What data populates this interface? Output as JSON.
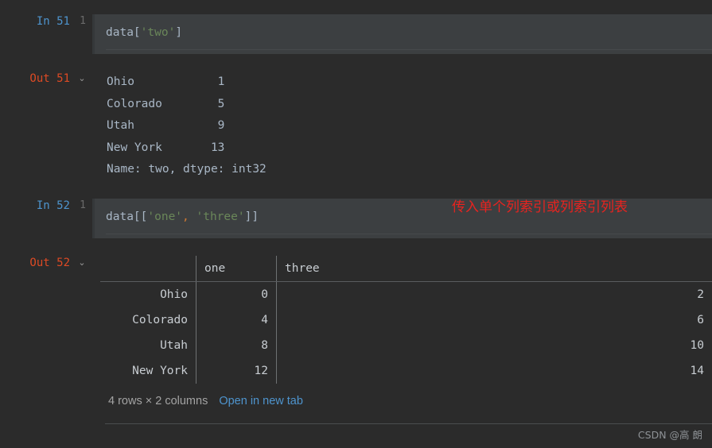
{
  "cells": [
    {
      "type": "input",
      "prompt_label": "In 51",
      "line_number": "1",
      "code_tokens": [
        {
          "text": "data",
          "kind": "name"
        },
        {
          "text": "[",
          "kind": "brack"
        },
        {
          "text": "'two'",
          "kind": "str"
        },
        {
          "text": "]",
          "kind": "brack"
        }
      ],
      "code_plain": "data['two']"
    },
    {
      "type": "output_text",
      "prompt_label": "Out 51",
      "collapse_icon": "chevron-down-icon",
      "lines": [
        "Ohio            1",
        "Colorado        5",
        "Utah            9",
        "New York       13",
        "Name: two, dtype: int32"
      ]
    },
    {
      "type": "input",
      "prompt_label": "In 52",
      "line_number": "1",
      "code_tokens": [
        {
          "text": "data",
          "kind": "name"
        },
        {
          "text": "[[",
          "kind": "brack"
        },
        {
          "text": "'one'",
          "kind": "str"
        },
        {
          "text": ",",
          "kind": "punct"
        },
        {
          "text": " ",
          "kind": "name"
        },
        {
          "text": "'three'",
          "kind": "str"
        },
        {
          "text": "]]",
          "kind": "brack"
        }
      ],
      "code_plain": "data[['one', 'three']]",
      "annotation": {
        "text": "传入单个列索引或列索引列表",
        "color": "#e8231f"
      }
    },
    {
      "type": "output_table",
      "prompt_label": "Out 52",
      "collapse_icon": "chevron-down-icon"
    }
  ],
  "dataframe": {
    "index_header": "",
    "columns": [
      "one",
      "three"
    ],
    "index": [
      "Ohio",
      "Colorado",
      "Utah",
      "New York"
    ],
    "rows": [
      [
        "0",
        "2"
      ],
      [
        "4",
        "6"
      ],
      [
        "8",
        "10"
      ],
      [
        "12",
        "14"
      ]
    ],
    "footer": {
      "shape_text": "4 rows × 2 columns",
      "open_link_label": "Open in new tab"
    }
  },
  "icons": {
    "chevron_down": "⌄"
  },
  "watermark": {
    "text": "CSDN @高 朗"
  },
  "colors": {
    "page_background": "#2b2b2b",
    "code_background": "#3c3f41",
    "in_prompt": "#4e94ce",
    "out_prompt": "#dd4a24",
    "string_token": "#6a8759",
    "punct_token": "#cc7832",
    "foreground": "#a9b7c6",
    "link": "#4e94ce",
    "annotation_red": "#e8231f"
  }
}
